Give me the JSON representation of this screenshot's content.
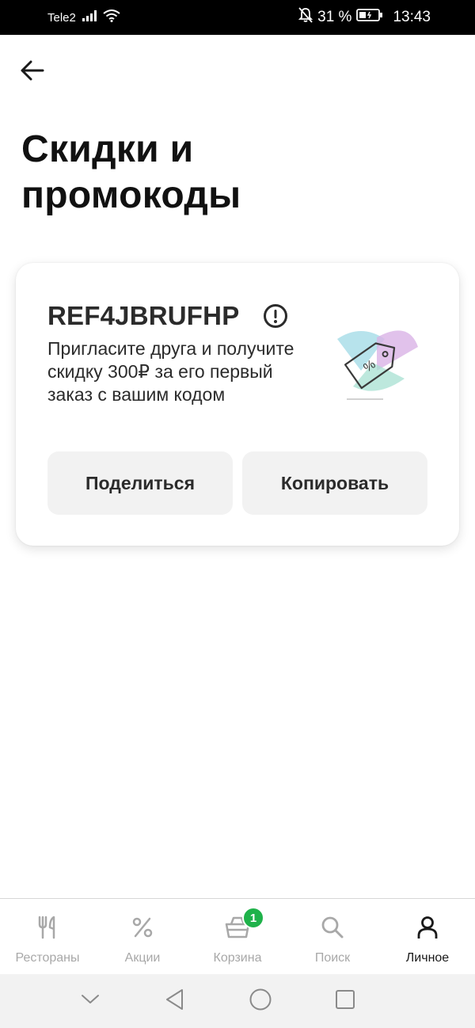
{
  "status_bar": {
    "carrier": "Tele2",
    "battery_percent": "31 %",
    "time": "13:43"
  },
  "page": {
    "title": "Скидки и\nпромокоды"
  },
  "promo_card": {
    "code": "REF4JBRUFHP",
    "description": "Пригласите друга и получите скидку 300₽ за его первый заказ с вашим кодом",
    "share_label": "Поделиться",
    "copy_label": "Копировать"
  },
  "tabbar": {
    "tabs": [
      {
        "label": "Рестораны",
        "icon": "fork-knife-icon"
      },
      {
        "label": "Акции",
        "icon": "percent-icon"
      },
      {
        "label": "Корзина",
        "icon": "basket-icon",
        "badge": "1"
      },
      {
        "label": "Поиск",
        "icon": "search-icon"
      },
      {
        "label": "Личное",
        "icon": "person-icon",
        "active": true
      }
    ]
  },
  "colors": {
    "accent_green": "#1fb24a",
    "text_dark": "#1a1a1a",
    "tab_inactive": "#a8a8a8",
    "button_bg": "#f2f2f2"
  }
}
